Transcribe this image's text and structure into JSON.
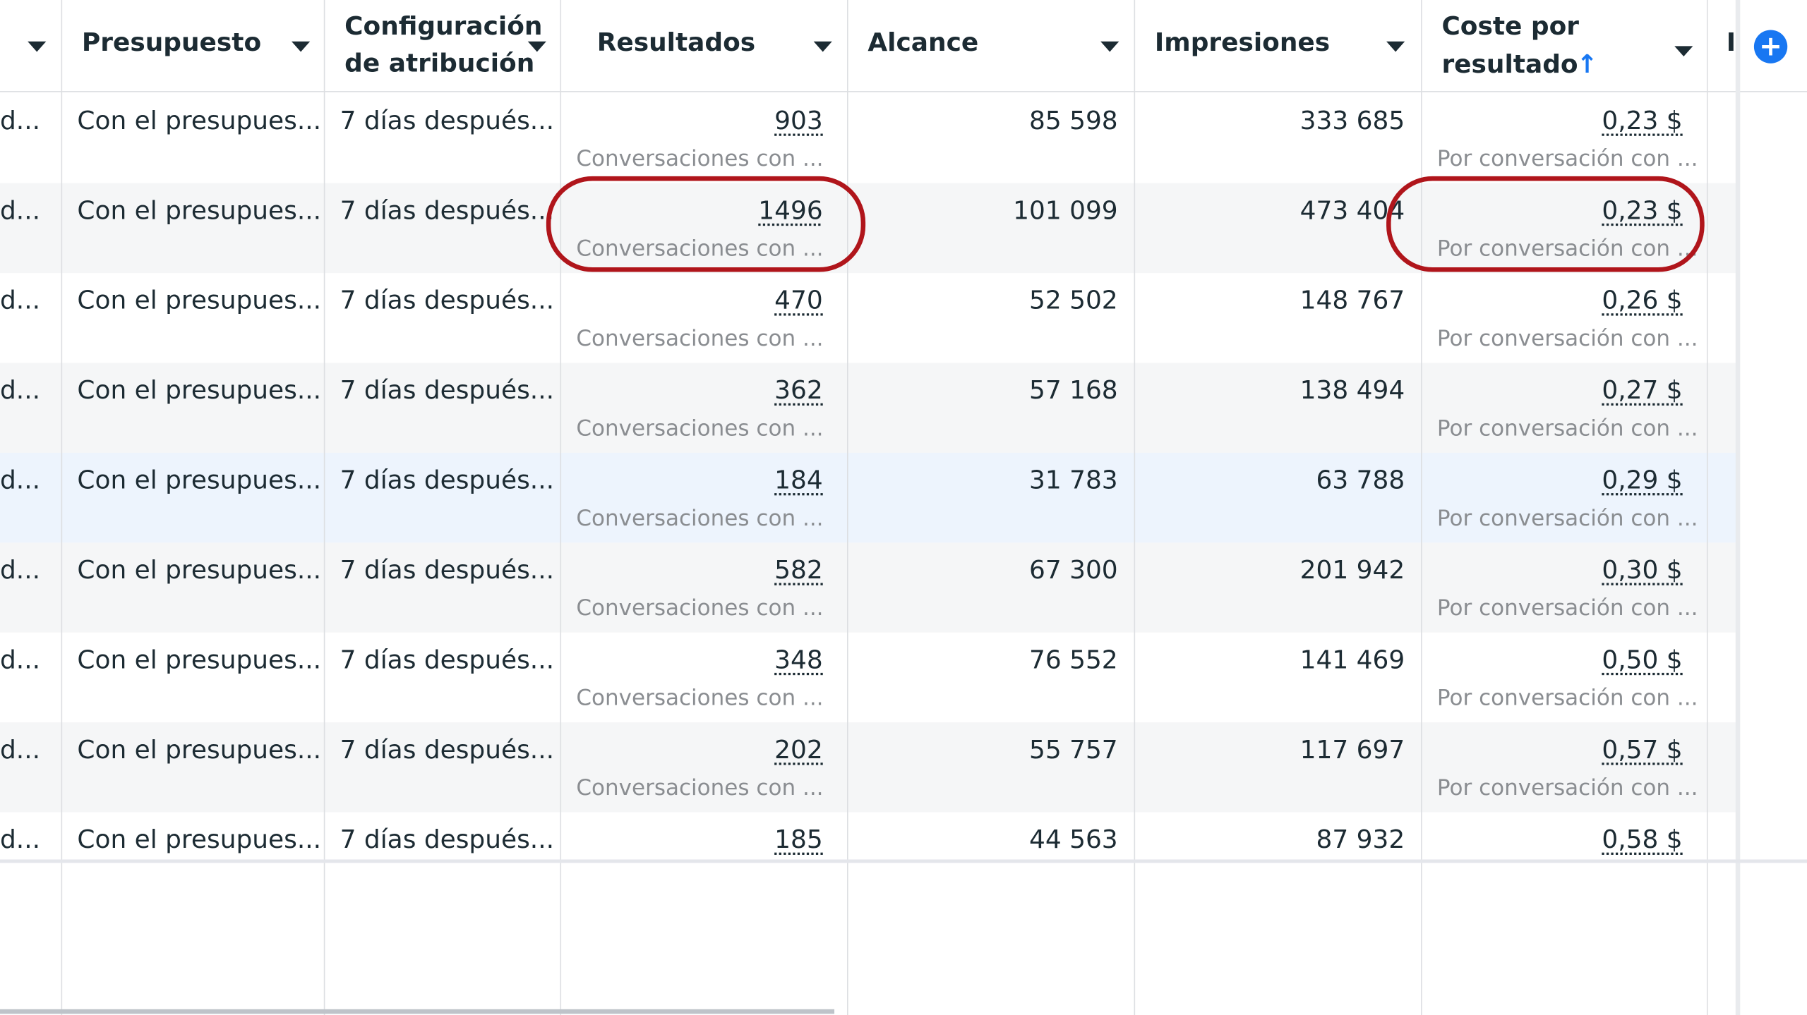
{
  "columns": {
    "first_partial": "",
    "budget": "Presupuesto",
    "attribution_line1": "Configuración",
    "attribution_line2": "de atribución",
    "results": "Resultados",
    "reach": "Alcance",
    "impressions": "Impresiones",
    "cost_line1": "Coste por",
    "cost_line2": "resultado",
    "cost_sort_icon": "↑",
    "next_partial": "I",
    "add_column_icon": "+"
  },
  "rows": [
    {
      "first": "d...",
      "budget": "Con el presupues...",
      "attribution": "7 días después...",
      "results": "903",
      "results_sub": "Conversaciones con ...",
      "reach": "85 598",
      "impressions": "333 685",
      "cost": "0,23 $",
      "cost_sub": "Por conversación con ..."
    },
    {
      "first": "d...",
      "budget": "Con el presupues...",
      "attribution": "7 días después...",
      "results": "1496",
      "results_sub": "Conversaciones con ...",
      "reach": "101 099",
      "impressions": "473 404",
      "cost": "0,23 $",
      "cost_sub": "Por conversación con ..."
    },
    {
      "first": "d...",
      "budget": "Con el presupues...",
      "attribution": "7 días después...",
      "results": "470",
      "results_sub": "Conversaciones con ...",
      "reach": "52 502",
      "impressions": "148 767",
      "cost": "0,26 $",
      "cost_sub": "Por conversación con ..."
    },
    {
      "first": "d...",
      "budget": "Con el presupues...",
      "attribution": "7 días después...",
      "results": "362",
      "results_sub": "Conversaciones con ...",
      "reach": "57 168",
      "impressions": "138 494",
      "cost": "0,27 $",
      "cost_sub": "Por conversación con ..."
    },
    {
      "first": "d...",
      "budget": "Con el presupues...",
      "attribution": "7 días después...",
      "results": "184",
      "results_sub": "Conversaciones con ...",
      "reach": "31 783",
      "impressions": "63 788",
      "cost": "0,29 $",
      "cost_sub": "Por conversación con ..."
    },
    {
      "first": "d...",
      "budget": "Con el presupues...",
      "attribution": "7 días después...",
      "results": "582",
      "results_sub": "Conversaciones con ...",
      "reach": "67 300",
      "impressions": "201 942",
      "cost": "0,30 $",
      "cost_sub": "Por conversación con ..."
    },
    {
      "first": "d...",
      "budget": "Con el presupues...",
      "attribution": "7 días después...",
      "results": "348",
      "results_sub": "Conversaciones con ...",
      "reach": "76 552",
      "impressions": "141 469",
      "cost": "0,50 $",
      "cost_sub": "Por conversación con ..."
    },
    {
      "first": "d...",
      "budget": "Con el presupues...",
      "attribution": "7 días después...",
      "results": "202",
      "results_sub": "Conversaciones con ...",
      "reach": "55 757",
      "impressions": "117 697",
      "cost": "0,57 $",
      "cost_sub": "Por conversación con ..."
    },
    {
      "first": "d...",
      "budget": "Con el presupues...",
      "attribution": "7 días después...",
      "results": "185",
      "results_sub": "",
      "reach": "44 563",
      "impressions": "87 932",
      "cost": "0,58 $",
      "cost_sub": ""
    }
  ],
  "colors": {
    "annotation_circle": "#b0151b",
    "accent": "#1877f2",
    "highlight_row": "#edf4fd",
    "alt_row": "#f5f6f7"
  }
}
